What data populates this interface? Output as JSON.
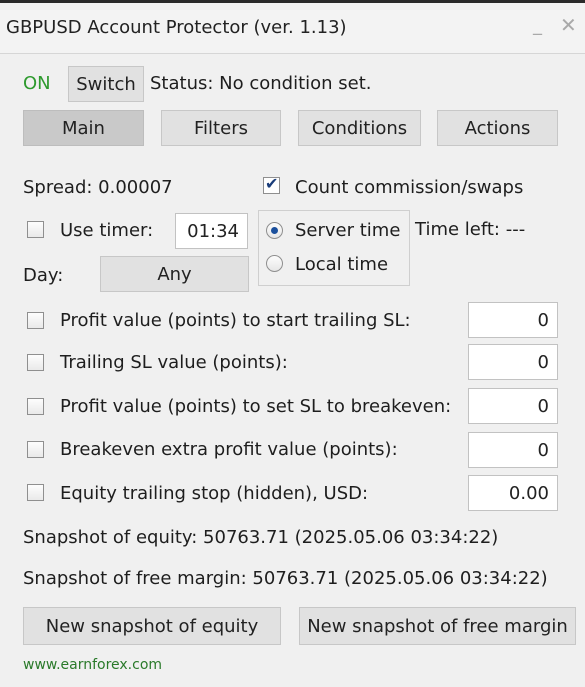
{
  "window": {
    "title": "GBPUSD Account Protector (ver. 1.13)",
    "minimize_glyph": "_",
    "close_glyph": "✕"
  },
  "header": {
    "status_on": "ON",
    "switch_label": "Switch",
    "status_text": "Status: No condition set."
  },
  "tabs": [
    {
      "label": "Main",
      "active": true
    },
    {
      "label": "Filters",
      "active": false
    },
    {
      "label": "Conditions",
      "active": false
    },
    {
      "label": "Actions",
      "active": false
    }
  ],
  "main": {
    "spread_text": "Spread: 0.00007",
    "count_commission": {
      "label": "Count commission/swaps",
      "checked": true
    },
    "use_timer": {
      "label": "Use timer:",
      "checked": false,
      "value": "01:34"
    },
    "time_mode": {
      "server_label": "Server time",
      "local_label": "Local time",
      "selected": "server"
    },
    "time_left_text": "Time left: ---",
    "day_label": "Day:",
    "day_value": "Any",
    "rows": [
      {
        "label": "Profit value (points) to start trailing SL:",
        "checked": false,
        "value": "0"
      },
      {
        "label": "Trailing SL value (points):",
        "checked": false,
        "value": "0"
      },
      {
        "label": "Profit value (points) to set SL to breakeven:",
        "checked": false,
        "value": "0"
      },
      {
        "label": "Breakeven extra profit value (points):",
        "checked": false,
        "value": "0"
      },
      {
        "label": "Equity trailing stop (hidden), USD:",
        "checked": false,
        "value": "0.00"
      }
    ],
    "snapshot_equity_text": "Snapshot of equity: 50763.71 (2025.05.06 03:34:22)",
    "snapshot_margin_text": "Snapshot of free margin: 50763.71 (2025.05.06 03:34:22)",
    "new_snapshot_equity_label": "New snapshot of equity",
    "new_snapshot_margin_label": "New snapshot of free margin"
  },
  "footer": {
    "link": "www.earnforex.com"
  },
  "colors": {
    "on_green": "#2e9a2e",
    "link_green": "#2a7a2a",
    "check_blue": "#1a3d7a"
  }
}
